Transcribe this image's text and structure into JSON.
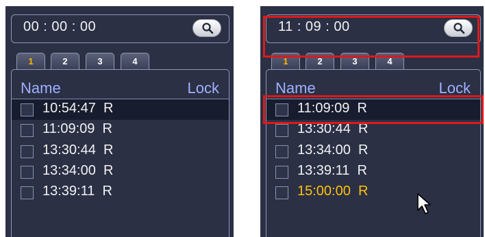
{
  "left_panel": {
    "time": "00 : 00 : 00",
    "tabs": [
      "1",
      "2",
      "3",
      "4"
    ],
    "active_tab": "1",
    "columns": {
      "name": "Name",
      "lock": "Lock"
    },
    "rows": [
      {
        "time": "10:54:47",
        "flag": "R",
        "selected": true
      },
      {
        "time": "11:09:09",
        "flag": "R"
      },
      {
        "time": "13:30:44",
        "flag": "R"
      },
      {
        "time": "13:34:00",
        "flag": "R"
      },
      {
        "time": "13:39:11",
        "flag": "R"
      }
    ]
  },
  "right_panel": {
    "time": "11 : 09 : 00",
    "tabs": [
      "1",
      "2",
      "3",
      "4"
    ],
    "active_tab": "1",
    "columns": {
      "name": "Name",
      "lock": "Lock"
    },
    "rows": [
      {
        "time": "11:09:09",
        "flag": "R",
        "selected": true
      },
      {
        "time": "13:30:44",
        "flag": "R"
      },
      {
        "time": "13:34:00",
        "flag": "R"
      },
      {
        "time": "13:39:11",
        "flag": "R"
      },
      {
        "time": "15:00:00",
        "flag": "R",
        "highlight_color": "#ffc107"
      }
    ]
  },
  "colors": {
    "panel_bg": "#2b3045",
    "header_text": "#9fb1ff",
    "active_tab_text": "#ffb400",
    "annotation_red": "#e01818"
  },
  "icons": [
    "search-icon",
    "mouse-cursor-icon"
  ]
}
